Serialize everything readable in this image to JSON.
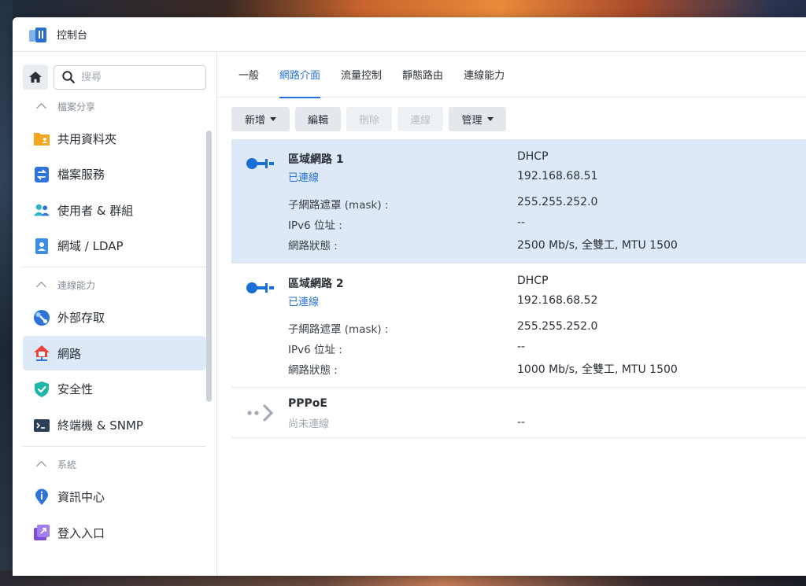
{
  "window": {
    "title": "控制台"
  },
  "search": {
    "placeholder": "搜尋"
  },
  "sidebar": {
    "sections": [
      {
        "header": "檔案分享",
        "items": [
          "共用資料夾",
          "檔案服務",
          "使用者 & 群組",
          "網域 / LDAP"
        ]
      },
      {
        "header": "連線能力",
        "items": [
          "外部存取",
          "網路",
          "安全性",
          "終端機 & SNMP"
        ]
      },
      {
        "header": "系統",
        "items": [
          "資訊中心",
          "登入入口"
        ]
      }
    ],
    "active_item": "網路"
  },
  "tabs": [
    "一般",
    "網路介面",
    "流量控制",
    "靜態路由",
    "連線能力"
  ],
  "active_tab": "網路介面",
  "toolbar": {
    "create": "新增",
    "edit": "編輯",
    "delete": "刪除",
    "connect": "連線",
    "manage": "管理"
  },
  "interfaces": [
    {
      "name": "區域網路 1",
      "status": "已連線",
      "mode": "DHCP",
      "ip": "192.168.68.51",
      "mask_label": "子網路遮罩 (mask) :",
      "mask": "255.255.252.0",
      "ipv6_label": "IPv6 位址 :",
      "ipv6": "--",
      "state_label": "網路狀態 :",
      "state": "2500 Mb/s, 全雙工, MTU 1500"
    },
    {
      "name": "區域網路 2",
      "status": "已連線",
      "mode": "DHCP",
      "ip": "192.168.68.52",
      "mask_label": "子網路遮罩 (mask) :",
      "mask": "255.255.252.0",
      "ipv6_label": "IPv6 位址 :",
      "ipv6": "--",
      "state_label": "網路狀態 :",
      "state": "1000 Mb/s, 全雙工, MTU 1500"
    },
    {
      "name": "PPPoE",
      "status": "尚未連線",
      "ip": "--"
    }
  ],
  "colors": {
    "accent": "#2570d4",
    "selected_bg": "#dde9f7"
  }
}
